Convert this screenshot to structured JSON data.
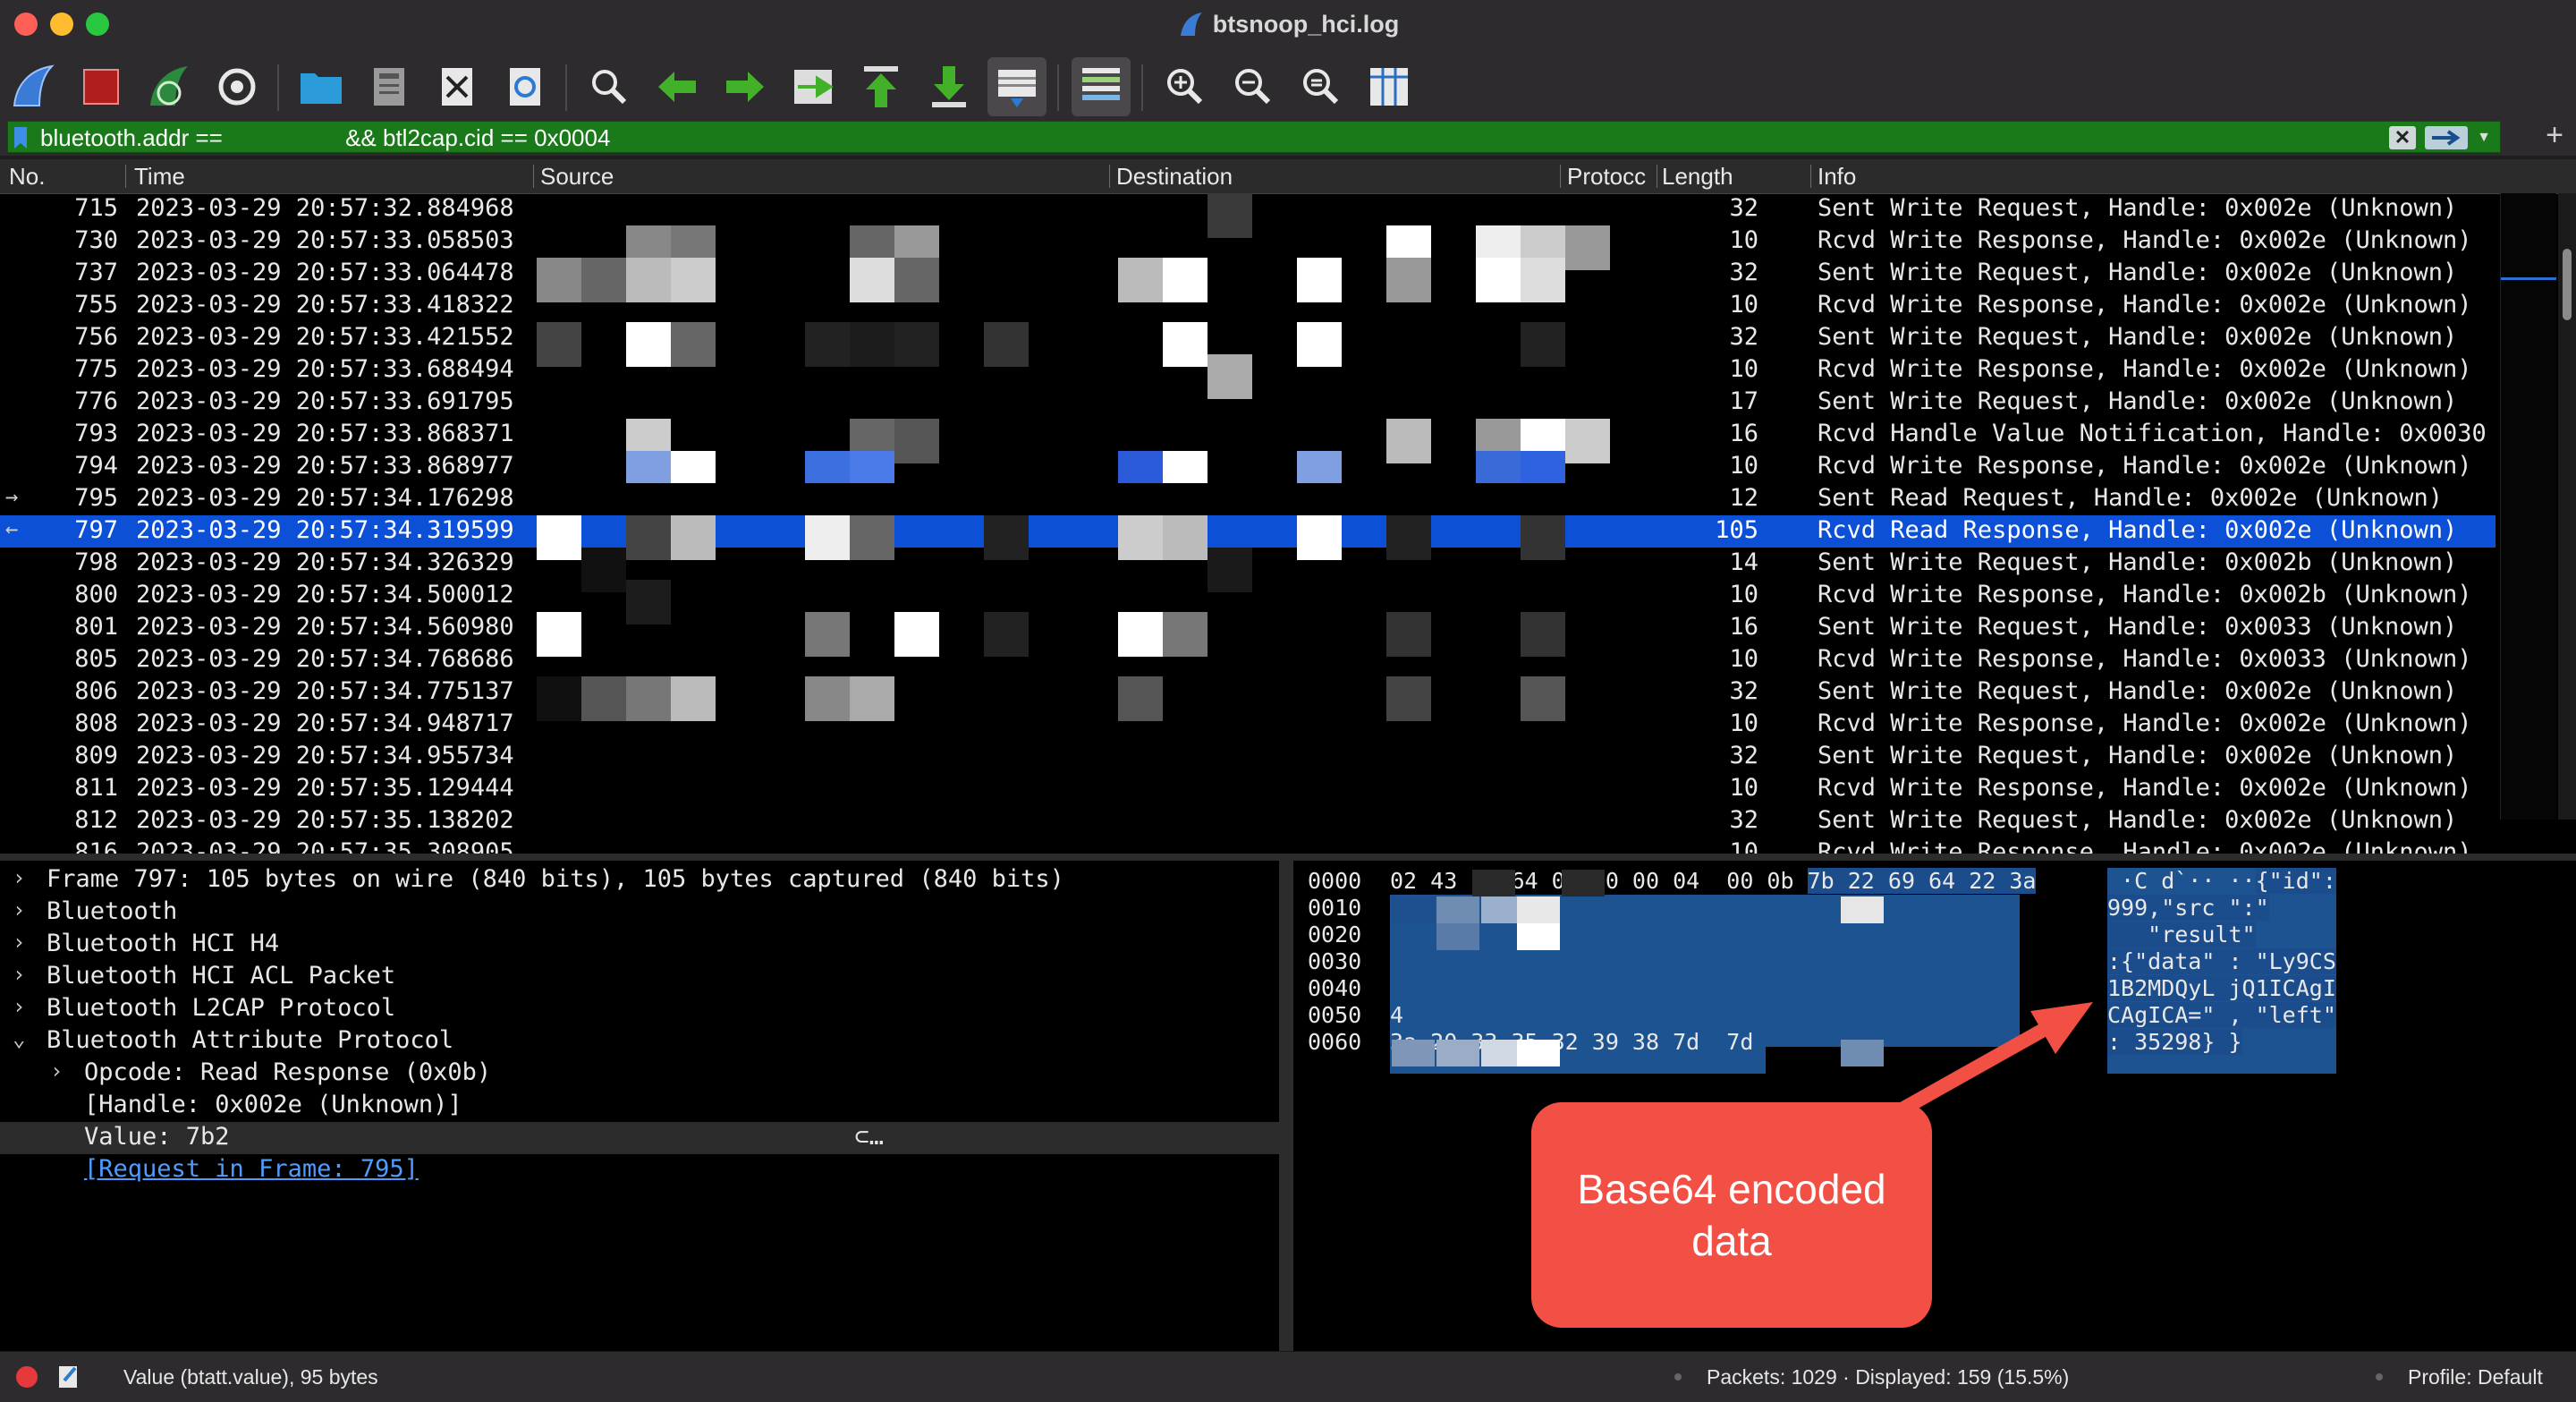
{
  "window": {
    "title": "btsnoop_hci.log"
  },
  "toolbar": {
    "buttons": [
      "start-capture-icon",
      "stop-capture-icon",
      "restart-capture-icon",
      "capture-options-icon",
      "open-file-icon",
      "save-file-icon",
      "close-file-icon",
      "reload-file-icon",
      "find-packet-icon",
      "go-back-icon",
      "go-forward-icon",
      "go-to-packet-icon",
      "first-packet-icon",
      "last-packet-icon",
      "auto-scroll-icon",
      "colorize-icon",
      "zoom-in-icon",
      "zoom-out-icon",
      "normal-size-icon",
      "resize-columns-icon"
    ]
  },
  "filter": {
    "text": "bluetooth.addr ==                   && btl2cap.cid == 0x0004",
    "clear_label": "✕",
    "add_label": "+"
  },
  "columns": [
    "No.",
    "Time",
    "Source",
    "Destination",
    "Protocc",
    "Length",
    "Info"
  ],
  "packets": [
    {
      "no": "715",
      "time": "2023-03-29 20:57:32.884968",
      "len": "32",
      "info": "Sent Write Request, Handle: 0x002e (Unknown)"
    },
    {
      "no": "730",
      "time": "2023-03-29 20:57:33.058503",
      "len": "10",
      "info": "Rcvd Write Response, Handle: 0x002e (Unknown)"
    },
    {
      "no": "737",
      "time": "2023-03-29 20:57:33.064478",
      "len": "32",
      "info": "Sent Write Request, Handle: 0x002e (Unknown)"
    },
    {
      "no": "755",
      "time": "2023-03-29 20:57:33.418322",
      "len": "10",
      "info": "Rcvd Write Response, Handle: 0x002e (Unknown)"
    },
    {
      "no": "756",
      "time": "2023-03-29 20:57:33.421552",
      "len": "32",
      "info": "Sent Write Request, Handle: 0x002e (Unknown)"
    },
    {
      "no": "775",
      "time": "2023-03-29 20:57:33.688494",
      "len": "10",
      "info": "Rcvd Write Response, Handle: 0x002e (Unknown)"
    },
    {
      "no": "776",
      "time": "2023-03-29 20:57:33.691795",
      "len": "17",
      "info": "Sent Write Request, Handle: 0x002e (Unknown)"
    },
    {
      "no": "793",
      "time": "2023-03-29 20:57:33.868371",
      "len": "16",
      "info": "Rcvd Handle Value Notification, Handle: 0x0030 ("
    },
    {
      "no": "794",
      "time": "2023-03-29 20:57:33.868977",
      "len": "10",
      "info": "Rcvd Write Response, Handle: 0x002e (Unknown)"
    },
    {
      "no": "795",
      "time": "2023-03-29 20:57:34.176298",
      "len": "12",
      "info": "Sent Read Request, Handle: 0x002e (Unknown)",
      "mark": "→"
    },
    {
      "no": "797",
      "time": "2023-03-29 20:57:34.319599",
      "len": "105",
      "info": "Rcvd Read Response, Handle: 0x002e (Unknown)",
      "mark": "←",
      "selected": true
    },
    {
      "no": "798",
      "time": "2023-03-29 20:57:34.326329",
      "len": "14",
      "info": "Sent Write Request, Handle: 0x002b (Unknown)"
    },
    {
      "no": "800",
      "time": "2023-03-29 20:57:34.500012",
      "len": "10",
      "info": "Rcvd Write Response, Handle: 0x002b (Unknown)"
    },
    {
      "no": "801",
      "time": "2023-03-29 20:57:34.560980",
      "len": "16",
      "info": "Sent Write Request, Handle: 0x0033 (Unknown)"
    },
    {
      "no": "805",
      "time": "2023-03-29 20:57:34.768686",
      "len": "10",
      "info": "Rcvd Write Response, Handle: 0x0033 (Unknown)"
    },
    {
      "no": "806",
      "time": "2023-03-29 20:57:34.775137",
      "len": "32",
      "info": "Sent Write Request, Handle: 0x002e (Unknown)"
    },
    {
      "no": "808",
      "time": "2023-03-29 20:57:34.948717",
      "len": "10",
      "info": "Rcvd Write Response, Handle: 0x002e (Unknown)"
    },
    {
      "no": "809",
      "time": "2023-03-29 20:57:34.955734",
      "len": "32",
      "info": "Sent Write Request, Handle: 0x002e (Unknown)"
    },
    {
      "no": "811",
      "time": "2023-03-29 20:57:35.129444",
      "len": "10",
      "info": "Rcvd Write Response, Handle: 0x002e (Unknown)"
    },
    {
      "no": "812",
      "time": "2023-03-29 20:57:35.138202",
      "len": "32",
      "info": "Sent Write Request, Handle: 0x002e (Unknown)"
    },
    {
      "no": "816",
      "time": "2023-03-29 20:57:35.308905",
      "len": "10",
      "info": "Rcvd Write Response, Handle: 0x002e (Unknown)"
    }
  ],
  "details": [
    {
      "text": "Frame 797: 105 bytes on wire (840 bits), 105 bytes captured (840 bits)",
      "expander": "›",
      "level": 0
    },
    {
      "text": "Bluetooth",
      "expander": "›",
      "level": 0
    },
    {
      "text": "Bluetooth HCI H4",
      "expander": "›",
      "level": 0
    },
    {
      "text": "Bluetooth HCI ACL Packet",
      "expander": "›",
      "level": 0
    },
    {
      "text": "Bluetooth L2CAP Protocol",
      "expander": "›",
      "level": 0
    },
    {
      "text": "Bluetooth Attribute Protocol",
      "expander": "⌄",
      "level": 0
    },
    {
      "text": "Opcode: Read Response (0x0b)",
      "expander": "›",
      "level": 1
    },
    {
      "text": "[Handle: 0x002e (Unknown)]",
      "expander": "",
      "level": 1
    },
    {
      "text": "Value: 7b2                                           ⊂…",
      "expander": "",
      "level": 1,
      "highlight": true
    },
    {
      "text": "[Request in Frame: 795]",
      "expander": "",
      "level": 1,
      "link": true
    }
  ],
  "bytes": {
    "offsets": [
      "0000",
      "0010",
      "0020",
      "0030",
      "0040",
      "0050",
      "0060"
    ],
    "row0_hex_plain": "02 43 20 64 00 60 00 04  00 0b ",
    "row0_hex_sel": "7b 22 69 64 22 3a",
    "row6_hex": "3a 20 33 35 32 39 38 7d  7d",
    "row4_hex_start": "4",
    "ascii": [
      {
        "plain": " ·C d`·· ··",
        "sel": "{\"id\":"
      },
      {
        "plain": "",
        "sel": "999,\"src \":\""
      },
      {
        "plain": "",
        "sel": "   \"result\""
      },
      {
        "plain": "",
        "sel": ":{\"data\" : \"Ly9CS"
      },
      {
        "plain": "",
        "sel": "1B2MDQyL jQ1ICAgI"
      },
      {
        "plain": "",
        "sel": "CAgICA=\" , \"left\""
      },
      {
        "plain": "",
        "sel": ": 35298} }"
      }
    ]
  },
  "annotation": {
    "text": "Base64 encoded data",
    "color": "#f24f45"
  },
  "status": {
    "field": "Value (btatt.value), 95 bytes",
    "packets": "Packets: 1029 · Displayed: 159 (15.5%)",
    "profile": "Profile: Default"
  },
  "colors": {
    "filter_valid": "#1a7a1a",
    "selection": "#0b50d6",
    "byte_selection": "#1b4c8c"
  }
}
